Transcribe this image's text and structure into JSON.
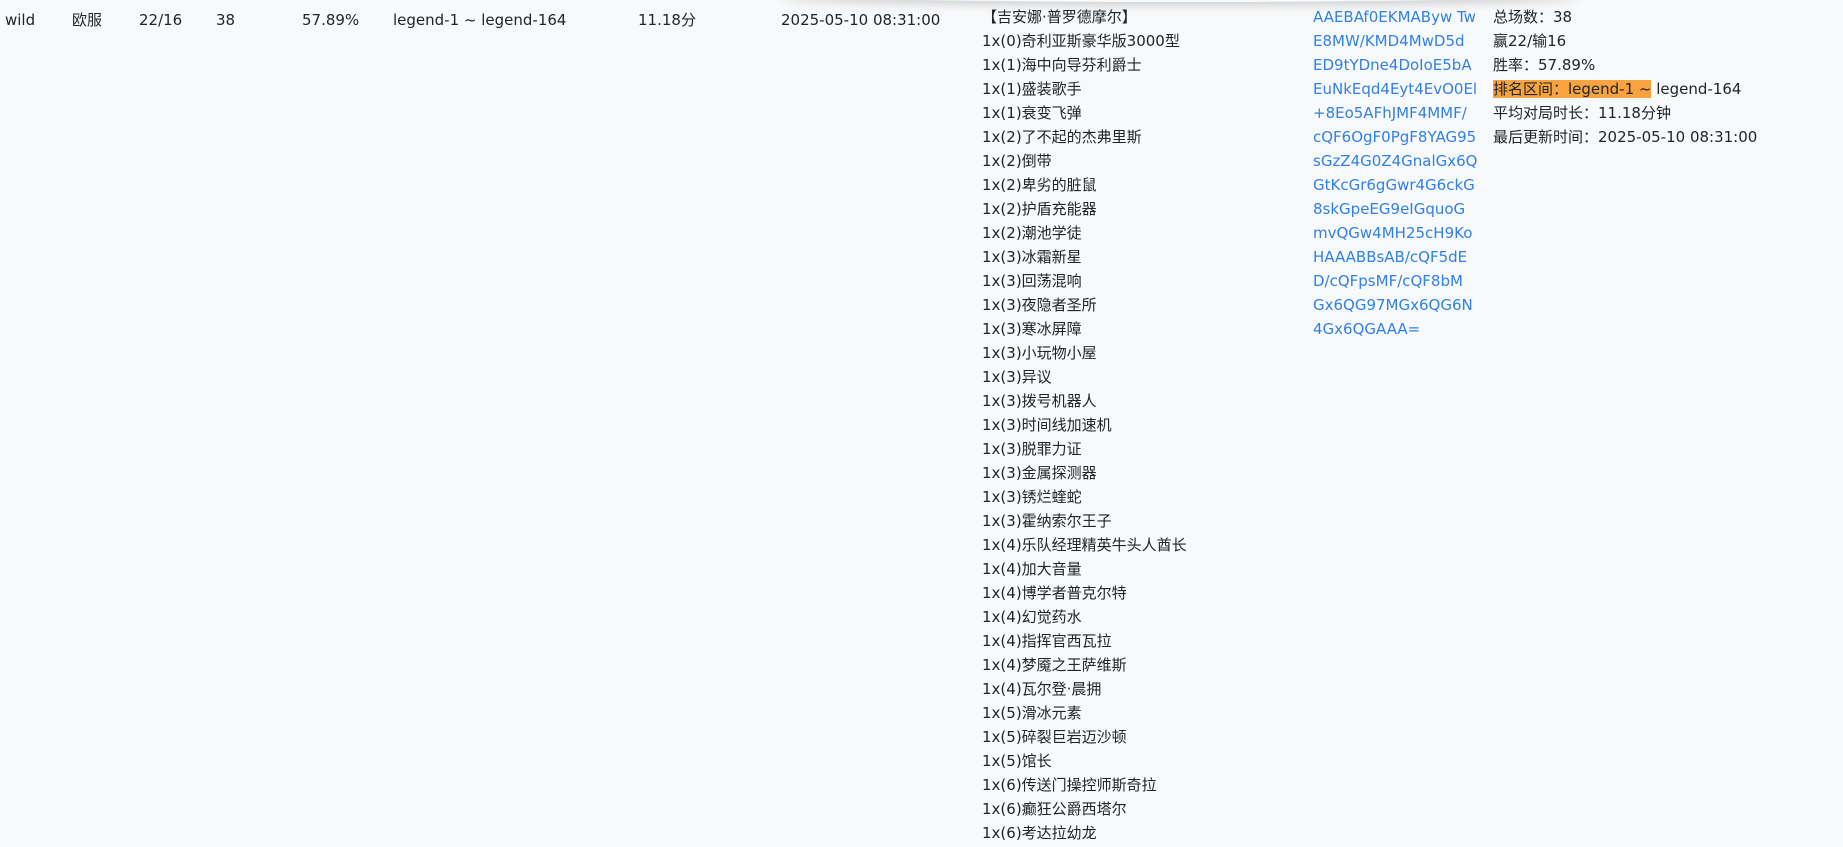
{
  "row": {
    "mode": "wild",
    "region": "欧服",
    "win_loss": "22/16",
    "total": "38",
    "win_rate": "57.89%",
    "rank_range": "legend-1 ~ legend-164",
    "avg_duration": "11.18分",
    "updated": "2025-05-10 08:31:00"
  },
  "deck": {
    "hero": "【吉安娜·普罗德摩尔】",
    "cards": [
      "1x(0)奇利亚斯豪华版3000型",
      "1x(1)海中向导芬利爵士",
      "1x(1)盛装歌手",
      "1x(1)衰变飞弹",
      "1x(2)了不起的杰弗里斯",
      "1x(2)倒带",
      "1x(2)卑劣的脏鼠",
      "1x(2)护盾充能器",
      "1x(2)潮池学徒",
      "1x(3)冰霜新星",
      "1x(3)回荡混响",
      "1x(3)夜隐者圣所",
      "1x(3)寒冰屏障",
      "1x(3)小玩物小屋",
      "1x(3)异议",
      "1x(3)拨号机器人",
      "1x(3)时间线加速机",
      "1x(3)脱罪力证",
      "1x(3)金属探测器",
      "1x(3)锈烂蝰蛇",
      "1x(3)霍纳索尔王子",
      "1x(4)乐队经理精英牛头人酋长",
      "1x(4)加大音量",
      "1x(4)博学者普克尔特",
      "1x(4)幻觉药水",
      "1x(4)指挥官西瓦拉",
      "1x(4)梦魇之王萨维斯",
      "1x(4)瓦尔登·晨拥",
      "1x(5)滑冰元素",
      "1x(5)碎裂巨岩迈沙顿",
      "1x(5)馆长",
      "1x(6)传送门操控师斯奇拉",
      "1x(6)癫狂公爵西塔尔",
      "1x(6)考达拉幼龙"
    ]
  },
  "deck_code": {
    "lines": [
      "AAEBAf0EKMAByw Tw",
      "E8MW/KMD4MwD5d",
      "ED9tYDne4DoIoE5bA",
      "EuNkEqd4Eyt4EvO0El",
      "+8Eo5AFhJMF4MMF/",
      "cQF6OgF0PgF8YAG95",
      "sGzZ4G0Z4GnalGx6Q",
      "GtKcGr6gGwr4G6ckG",
      "8skGpeEG9eIGquoG",
      "mvQGw4MH25cH9Ko",
      "HAAABBsAB/cQF5dE",
      "D/cQFpsMF/cQF8bM",
      "Gx6QG97MGx6QG6N",
      "4Gx6QGAAA="
    ]
  },
  "summary": {
    "total": "总场数：38",
    "win_loss": "赢22/输16",
    "win_rate": "胜率：57.89%",
    "rank_prefix": "排名区间：legend-1 ~",
    "rank_suffix": " legend-164",
    "avg_duration": "平均对局时长：11.18分钟",
    "updated": "最后更新时间：2025-05-10 08:31:00"
  },
  "colors": {
    "link": "#2f80e8",
    "highlight": "#f6a340",
    "background": "#f8f9fa"
  }
}
